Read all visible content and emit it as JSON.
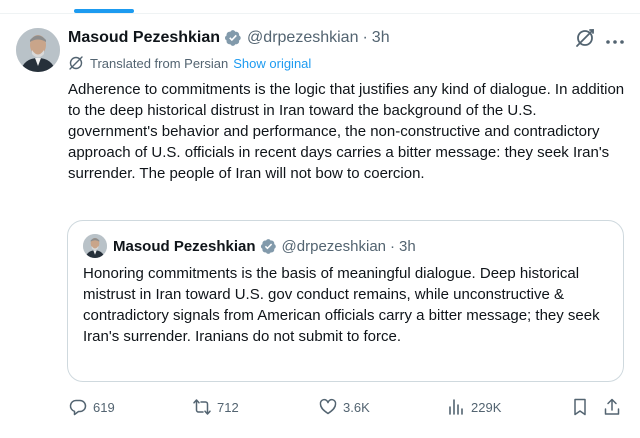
{
  "tweet": {
    "author_name": "Masoud Pezeshkian",
    "handle": "@drpezeshkian",
    "separator": "·",
    "time": "3h",
    "translated_label": "Translated from Persian",
    "show_original": "Show original",
    "text": "Adherence to commitments is the logic that justifies any kind of dialogue. In addition to the deep historical distrust in Iran toward the background of the U.S. government's behavior and performance, the non-constructive and contradictory approach of U.S. officials in recent days carries a bitter message: they seek Iran's surrender. The people of Iran will not bow to coercion."
  },
  "quote": {
    "author_name": "Masoud Pezeshkian",
    "handle": "@drpezeshkian",
    "separator": "·",
    "time": "3h",
    "text": "Honoring commitments is the basis of meaningful dialogue. Deep historical mistrust in Iran toward U.S. gov conduct remains, while unconstructive & contradictory signals from American officials carry a bitter message; they seek Iran's surrender. Iranians do not submit to force."
  },
  "actions": {
    "replies": "619",
    "reposts": "712",
    "likes": "3.6K",
    "views": "229K"
  },
  "colors": {
    "accent": "#1d9bf0",
    "secondary_text": "#536471",
    "primary_text": "#0f1419",
    "border": "#cfd9de",
    "verified_badge": "#829aab"
  },
  "icons": {
    "verified": "verified-badge-icon",
    "grok": "grok-icon",
    "more": "more-icon",
    "translate": "translate-icon",
    "reply": "reply-icon",
    "repost": "repost-icon",
    "like": "heart-icon",
    "views": "views-icon",
    "bookmark": "bookmark-icon",
    "share": "share-icon"
  }
}
